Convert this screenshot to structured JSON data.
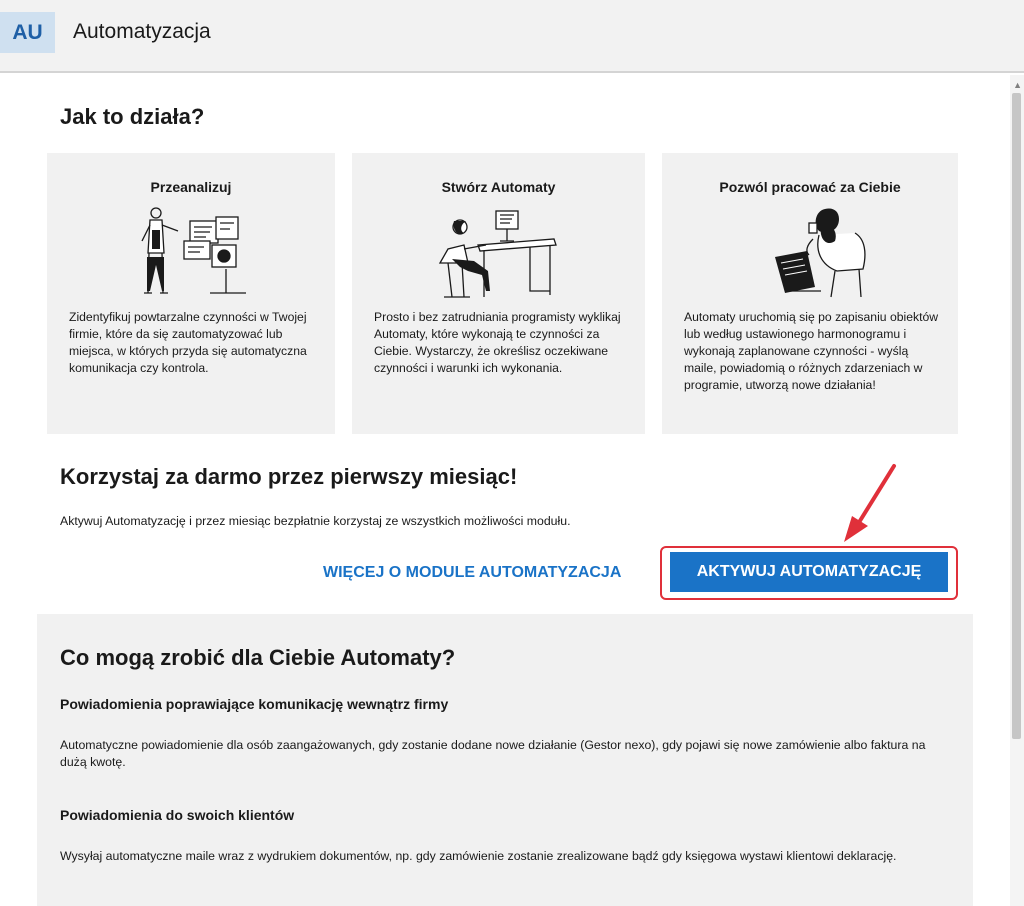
{
  "header": {
    "badge": "AU",
    "title": "Automatyzacja"
  },
  "how": {
    "title": "Jak to działa?",
    "cards": [
      {
        "title": "Przeanalizuj",
        "icon": "analyst-dashboard-illustration",
        "text": "Zidentyfikuj powtarzalne czynności w Twojej firmie, które da się zautomatyzować lub miejsca, w których przyda się automatyczna komunikacja czy kontrola."
      },
      {
        "title": "Stwórz Automaty",
        "icon": "desk-worker-illustration",
        "text": "Prosto i bez zatrudniania programisty wyklikaj Automaty, które wykonają te czynności za Ciebie. Wystarczy, że określisz oczekiwane czynności i warunki ich wykonania."
      },
      {
        "title": "Pozwól pracować za Ciebie",
        "icon": "relaxed-laptop-user-illustration",
        "text": "Automaty uruchomią się po zapisaniu obiektów lub według ustawionego harmonogramu i wykonają zaplanowane czynności - wyślą maile, powiadomią o różnych zdarzeniach w programie, utworzą nowe działania!"
      }
    ]
  },
  "promo": {
    "title": "Korzystaj za darmo przez pierwszy miesiąc!",
    "text": "Aktywuj Automatyzację i przez miesiąc bezpłatnie korzystaj ze wszystkich możliwości modułu.",
    "more_link": "WIĘCEJ O MODULE AUTOMATYZACJA",
    "activate_button": "AKTYWUJ AUTOMATYZACJĘ",
    "highlight_color": "#e0303a",
    "accent_color": "#1a73c7"
  },
  "features": {
    "title": "Co mogą zrobić dla Ciebie Automaty?",
    "items": [
      {
        "title": "Powiadomienia poprawiające komunikację wewnątrz firmy",
        "text": "Automatyczne powiadomienie dla osób zaangażowanych, gdy zostanie dodane nowe działanie (Gestor nexo), gdy pojawi się nowe zamówienie albo faktura na dużą kwotę."
      },
      {
        "title": "Powiadomienia do swoich klientów",
        "text": "Wysyłaj automatyczne maile wraz z wydrukiem dokumentów, np. gdy zamówienie zostanie zrealizowane bądź gdy księgowa wystawi klientowi deklarację."
      }
    ]
  }
}
